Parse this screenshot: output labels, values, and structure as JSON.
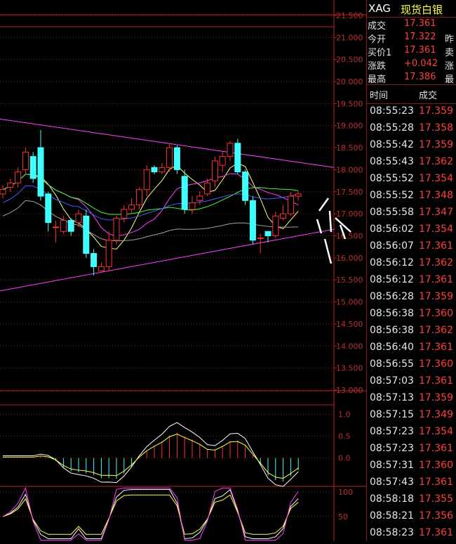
{
  "header": {
    "code": "XAG",
    "name": "现货白银"
  },
  "quote": [
    {
      "label": "成交",
      "value": "17.361",
      "extra": ""
    },
    {
      "label": "今开",
      "value": "17.322",
      "extra": "昨"
    },
    {
      "label": "买价1",
      "value": "17.361",
      "extra": "卖"
    },
    {
      "label": "涨跌",
      "value": "+0.042",
      "extra": "涨"
    },
    {
      "label": "最高",
      "value": "17.386",
      "extra": "最"
    }
  ],
  "ticks_header": {
    "time": "时间",
    "price": "成交"
  },
  "ticks": [
    {
      "time": "08:55:23",
      "price": "17.359"
    },
    {
      "time": "08:55:28",
      "price": "17.358"
    },
    {
      "time": "08:55:42",
      "price": "17.359"
    },
    {
      "time": "08:55:43",
      "price": "17.362"
    },
    {
      "time": "08:55:52",
      "price": "17.354"
    },
    {
      "time": "08:55:52",
      "price": "17.348"
    },
    {
      "time": "08:55:58",
      "price": "17.347"
    },
    {
      "time": "08:56:02",
      "price": "17.354"
    },
    {
      "time": "08:56:07",
      "price": "17.361"
    },
    {
      "time": "08:56:12",
      "price": "17.362"
    },
    {
      "time": "08:56:12",
      "price": "17.361"
    },
    {
      "time": "08:56:28",
      "price": "17.359"
    },
    {
      "time": "08:56:38",
      "price": "17.360"
    },
    {
      "time": "08:56:38",
      "price": "17.362"
    },
    {
      "time": "08:56:40",
      "price": "17.361"
    },
    {
      "time": "08:56:55",
      "price": "17.360"
    },
    {
      "time": "08:57:03",
      "price": "17.361"
    },
    {
      "time": "08:57:13",
      "price": "17.359"
    },
    {
      "time": "08:57:15",
      "price": "17.349"
    },
    {
      "time": "08:57:23",
      "price": "17.354"
    },
    {
      "time": "08:57:23",
      "price": "17.361"
    },
    {
      "time": "08:57:31",
      "price": "17.360"
    },
    {
      "time": "08:57:43",
      "price": "17.361"
    },
    {
      "time": "08:58:18",
      "price": "17.355"
    },
    {
      "time": "08:58:21",
      "price": "17.356"
    },
    {
      "time": "08:58:23",
      "price": "17.361"
    }
  ],
  "colors": {
    "up": "#ff3030",
    "down": "#40ffff",
    "grid": "#8a1a1a",
    "axis": "#c02020"
  },
  "chart_data": {
    "type": "candlestick",
    "price_axis": {
      "min": 13.0,
      "max": 21.5,
      "ticks": [
        "13.000",
        "13.500",
        "14.000",
        "14.500",
        "15.000",
        "15.500",
        "16.000",
        "16.500",
        "17.000",
        "17.500",
        "18.000",
        "18.500",
        "19.000",
        "19.500",
        "20.000",
        "20.500",
        "21.000",
        "21.500"
      ]
    },
    "macd_axis": {
      "min": -0.6,
      "max": 1.2,
      "ticks": [
        "0.0",
        "0.5",
        "1.0"
      ]
    },
    "kdj_axis": {
      "min": 0,
      "max": 110,
      "ticks": [
        "50",
        "100"
      ]
    },
    "candles": [
      [
        17.55,
        17.45,
        17.65,
        17.35
      ],
      [
        17.7,
        17.6,
        17.8,
        17.5
      ],
      [
        17.95,
        17.7,
        18.05,
        17.6
      ],
      [
        18.4,
        18.0,
        18.5,
        17.9
      ],
      [
        17.8,
        18.3,
        18.4,
        17.7
      ],
      [
        17.4,
        18.5,
        18.9,
        17.3
      ],
      [
        16.8,
        17.45,
        17.5,
        16.6
      ],
      [
        16.7,
        16.7,
        16.85,
        16.35
      ],
      [
        16.85,
        16.6,
        16.95,
        16.55
      ],
      [
        16.6,
        16.85,
        16.9,
        16.5
      ],
      [
        17.0,
        16.8,
        17.1,
        16.7
      ],
      [
        16.1,
        16.95,
        17.1,
        16.0
      ],
      [
        15.8,
        16.1,
        16.2,
        15.6
      ],
      [
        15.8,
        15.7,
        15.9,
        15.7
      ],
      [
        16.4,
        15.8,
        16.6,
        15.7
      ],
      [
        16.9,
        16.4,
        16.95,
        16.3
      ],
      [
        17.1,
        16.9,
        17.2,
        16.8
      ],
      [
        17.2,
        17.1,
        17.35,
        17.0
      ],
      [
        17.55,
        17.2,
        17.6,
        17.1
      ],
      [
        18.0,
        17.55,
        18.1,
        17.4
      ],
      [
        17.95,
        18.05,
        18.1,
        17.9
      ],
      [
        18.05,
        17.95,
        18.15,
        17.9
      ],
      [
        18.5,
        18.05,
        18.6,
        17.95
      ],
      [
        18.0,
        18.5,
        18.55,
        17.9
      ],
      [
        17.1,
        17.85,
        18.0,
        17.0
      ],
      [
        17.25,
        17.1,
        17.4,
        17.0
      ],
      [
        17.4,
        17.3,
        17.5,
        17.2
      ],
      [
        17.7,
        17.45,
        17.8,
        17.4
      ],
      [
        18.2,
        17.75,
        18.3,
        17.6
      ],
      [
        18.3,
        18.1,
        18.4,
        17.95
      ],
      [
        18.6,
        18.3,
        18.65,
        18.2
      ],
      [
        17.95,
        18.6,
        18.7,
        17.9
      ],
      [
        17.3,
        17.95,
        18.0,
        17.2
      ],
      [
        16.4,
        17.3,
        17.4,
        16.3
      ],
      [
        16.45,
        16.45,
        16.55,
        16.1
      ],
      [
        16.5,
        16.6,
        16.6,
        16.35
      ],
      [
        16.95,
        16.5,
        17.05,
        16.45
      ],
      [
        17.0,
        16.9,
        17.2,
        16.85
      ],
      [
        17.4,
        17.0,
        17.5,
        16.95
      ],
      [
        17.45,
        17.4,
        17.5,
        17.3
      ]
    ]
  }
}
